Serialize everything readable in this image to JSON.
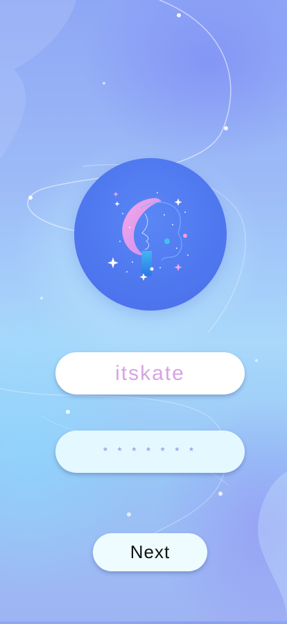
{
  "login": {
    "username_value": "itskate",
    "password_value": "* * * * * * *",
    "next_label": "Next"
  },
  "logo": {
    "icon": "moon-woman-logo-icon"
  },
  "colors": {
    "username_text": "#d7a3e4",
    "password_text": "#8f8fe0",
    "logo_circle": "#5580f2"
  }
}
